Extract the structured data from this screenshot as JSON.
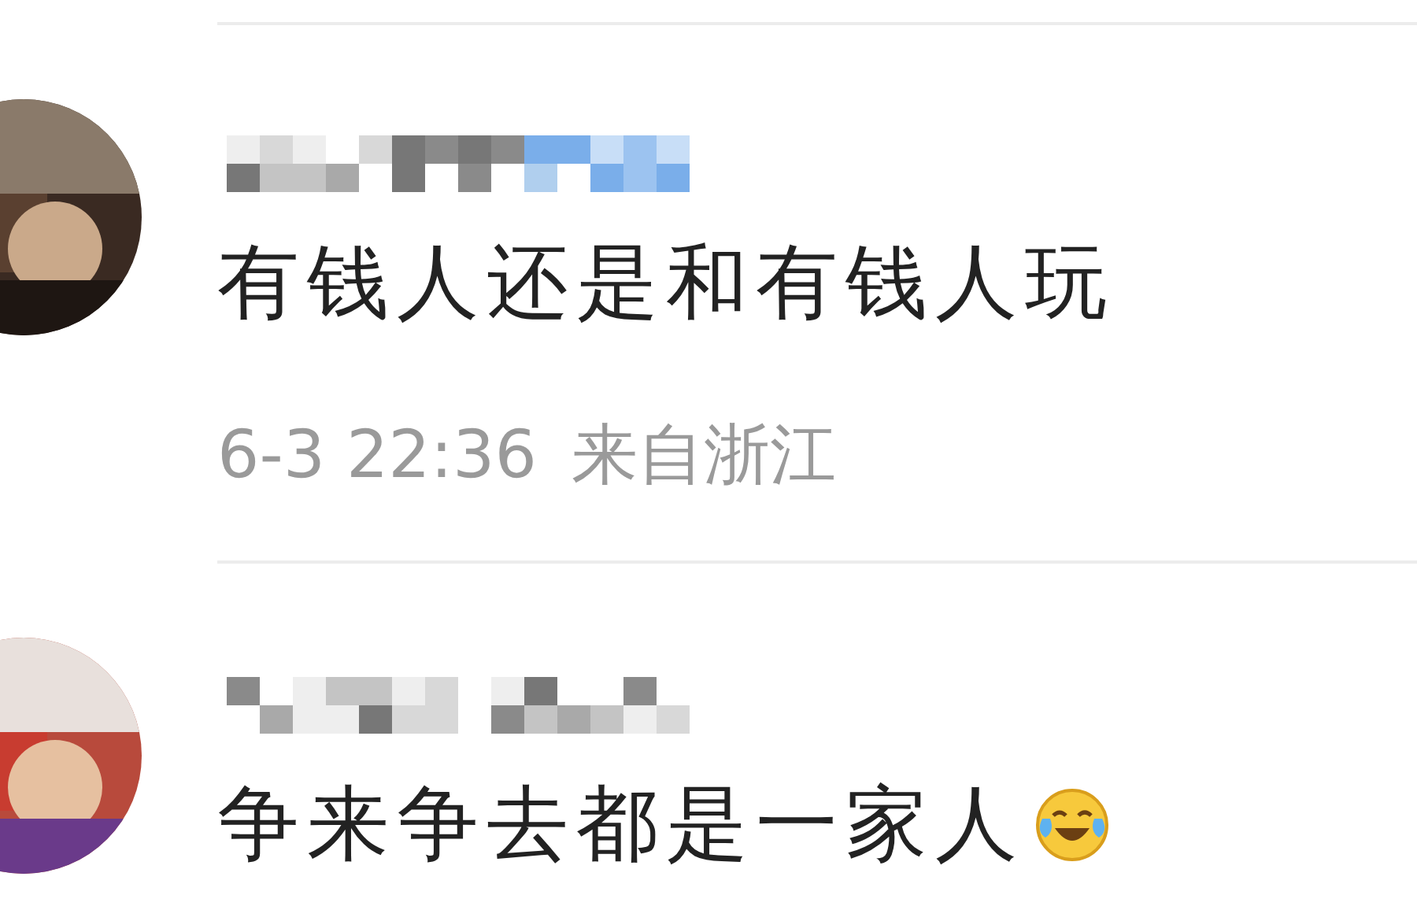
{
  "comments": [
    {
      "text": "有钱人还是和有钱人玩",
      "time": "6-3 22:36",
      "location": "来自浙江",
      "trailing_emoji": false
    },
    {
      "text": "争来争去都是一家人",
      "trailing_emoji": true
    }
  ]
}
